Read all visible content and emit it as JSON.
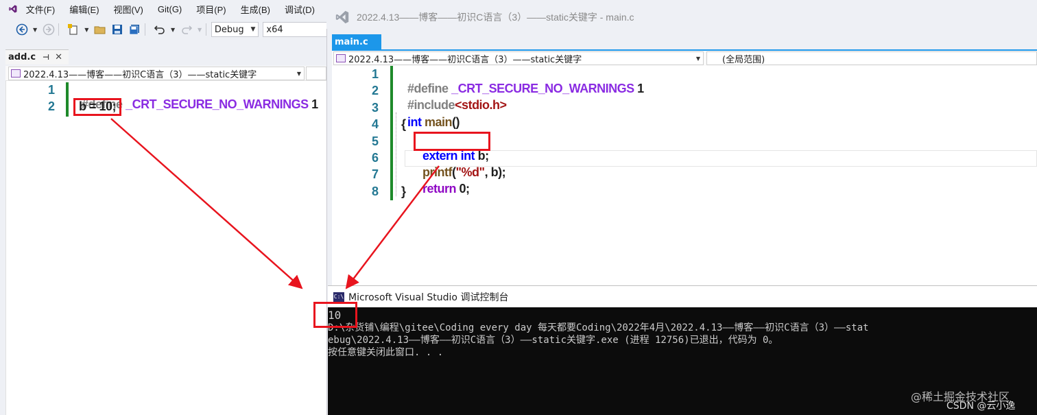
{
  "back_window": {
    "menu": [
      "文件(F)",
      "编辑(E)",
      "视图(V)",
      "Git(G)",
      "项目(P)",
      "生成(B)",
      "调试(D)"
    ],
    "config_value": "Debug",
    "platform_value": "x64",
    "tab_label": "add.c",
    "nav_scope": "2022.4.13——博客——初识C语言（3）——static关键字",
    "code_lines": [
      {
        "num": "1",
        "directive": "#define",
        "macro": "_CRT_SECURE_NO_WARNINGS",
        "value": "1"
      },
      {
        "num": "2",
        "text": "b = 10;"
      }
    ]
  },
  "front_window": {
    "title": "2022.4.13——博客——初识C语言（3）——static关键字 - main.c",
    "tab_label": "main.c",
    "nav_scope": "2022.4.13——博客——初识C语言（3）——static关键字",
    "nav_global": "(全局范围)",
    "line_numbers": [
      "1",
      "2",
      "3",
      "4",
      "5",
      "6",
      "7",
      "8"
    ],
    "tokens": {
      "define": "#define",
      "macro": "_CRT_SECURE_NO_WARNINGS",
      "one": "1",
      "include": "#include",
      "header": "<stdio.h>",
      "int": "int",
      "main": "main",
      "parens": "()",
      "lbrace": "{",
      "extern": "extern",
      "int2": "int",
      "b_decl": "b;",
      "printf": "printf",
      "lparen": "(",
      "fmt": "\"%d\"",
      "args": ", b);",
      "return": "return",
      "zero": "0;",
      "rbrace": "}"
    }
  },
  "console": {
    "title": "Microsoft Visual Studio 调试控制台",
    "lines": [
      "10",
      "D:\\杂货铺\\编程\\gitee\\Coding every day 每天都要Coding\\2022年4月\\2022.4.13——博客——初识C语言（3）——stat",
      "ebug\\2022.4.13——博客——初识C语言（3）——static关键字.exe (进程 12756)已退出，代码为 0。",
      "按任意键关闭此窗口. . ."
    ]
  },
  "watermarks": {
    "juejin": "@稀土掘金技术社区",
    "csdn": "CSDN @云小逸"
  },
  "colors": {
    "annotation_red": "#e8141e",
    "tab_active_blue": "#1c97ea",
    "changed_line_green": "#1e8a2a",
    "console_bg": "#0c0c0c"
  }
}
